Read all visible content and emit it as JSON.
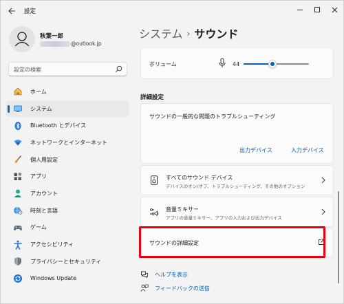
{
  "window": {
    "title": "設定",
    "icons": {
      "back": "back-arrow-icon",
      "minimize": "minimize-icon",
      "maximize": "maximize-icon",
      "close": "close-icon"
    }
  },
  "profile": {
    "name": "秋葉一郎",
    "email_suffix": "@outlook.jp"
  },
  "search": {
    "placeholder": "設定の検索"
  },
  "sidebar": {
    "items": [
      {
        "label": "ホーム",
        "icon": "home-icon",
        "active": false
      },
      {
        "label": "システム",
        "icon": "system-icon",
        "active": true
      },
      {
        "label": "Bluetooth とデバイス",
        "icon": "bluetooth-icon",
        "active": false
      },
      {
        "label": "ネットワークとインターネット",
        "icon": "network-icon",
        "active": false
      },
      {
        "label": "個人用設定",
        "icon": "personalization-icon",
        "active": false
      },
      {
        "label": "アプリ",
        "icon": "apps-icon",
        "active": false
      },
      {
        "label": "アカウント",
        "icon": "account-icon",
        "active": false
      },
      {
        "label": "時刻と言語",
        "icon": "time-language-icon",
        "active": false
      },
      {
        "label": "ゲーム",
        "icon": "gaming-icon",
        "active": false
      },
      {
        "label": "アクセシビリティ",
        "icon": "accessibility-icon",
        "active": false
      },
      {
        "label": "プライバシーとセキュリティ",
        "icon": "shield-icon",
        "active": false
      },
      {
        "label": "Windows Update",
        "icon": "windows-update-icon",
        "active": false
      }
    ]
  },
  "main": {
    "breadcrumb": {
      "parent": "システム",
      "separator": "›",
      "current": "サウンド"
    },
    "volume": {
      "label": "ボリューム",
      "value": "44",
      "level": 0.44
    },
    "advanced_section_title": "詳細設定",
    "troubleshoot": {
      "title": "サウンドの一般的な問題のトラブルシューティング",
      "output_link": "出力デバイス",
      "input_link": "入力デバイス"
    },
    "all_devices": {
      "title": "すべてのサウンド デバイス",
      "subtitle": "デバイスのオン/オフ、トラブルシューティング、その他のオプション"
    },
    "mixer": {
      "title": "音量ミキサー",
      "subtitle": "アプリの音量ミキサー、アプリの入力および出力デバイス"
    },
    "advanced": {
      "title": "サウンドの詳細設定"
    },
    "help_links": {
      "help": "ヘルプを表示",
      "feedback": "フィードバックの送信"
    }
  },
  "colors": {
    "accent": "#005fb8",
    "highlight_border": "#e50012",
    "sidebar_indicator": "#0067c0"
  }
}
